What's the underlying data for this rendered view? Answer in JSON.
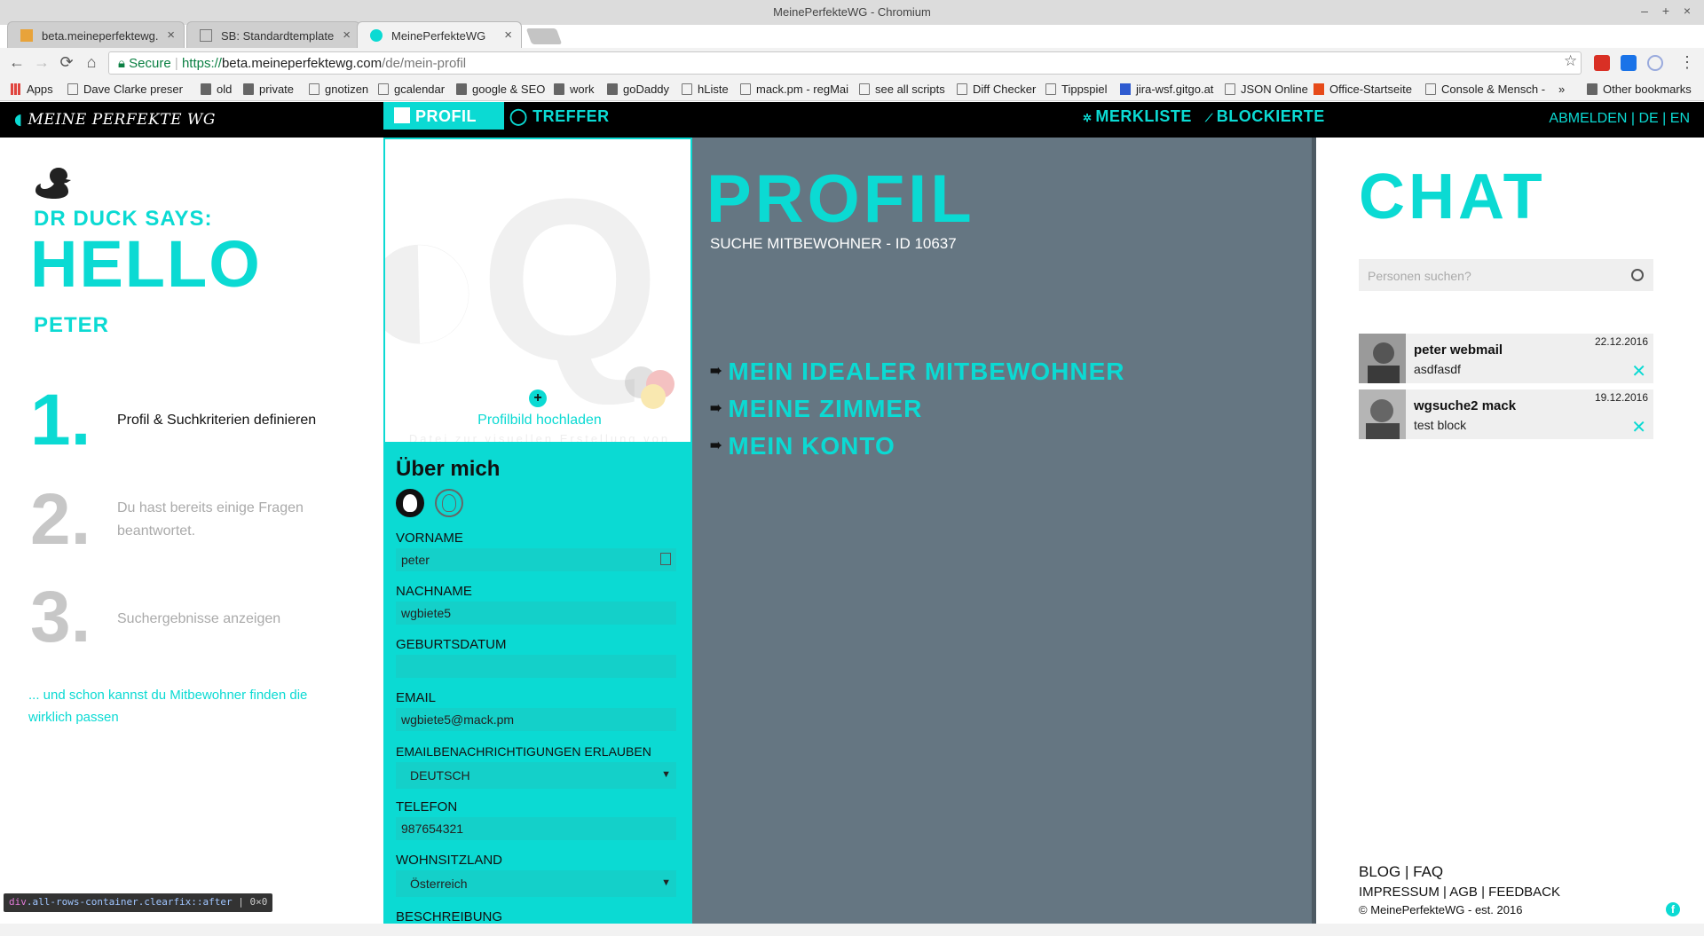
{
  "window": {
    "title": "MeinePerfekteWG - Chromium",
    "controls": [
      "–",
      "+",
      "×"
    ]
  },
  "tabs": [
    {
      "label": "beta.meineperfektewg.",
      "active": false,
      "close": "×"
    },
    {
      "label": "SB: Standardtemplate",
      "active": false,
      "close": "×"
    },
    {
      "label": "MeinePerfekteWG",
      "active": true,
      "close": "×"
    }
  ],
  "toolbar": {
    "back": "←",
    "forward": "→",
    "reload": "⟳",
    "home": "⌂",
    "secure_label": "Secure",
    "url_scheme": "https://",
    "url_host": "beta.meineperfektewg.com",
    "url_path": "/de/mein-profil",
    "star": "☆",
    "menu": "⋮"
  },
  "bookmarks": [
    {
      "label": "Apps",
      "icon": "apps-icon"
    },
    {
      "label": "Dave Clarke present",
      "icon": "page-icon"
    },
    {
      "label": "old",
      "icon": "folder-icon"
    },
    {
      "label": "private",
      "icon": "folder-icon"
    },
    {
      "label": "gnotizen",
      "icon": "page-icon"
    },
    {
      "label": "gcalendar",
      "icon": "page-icon"
    },
    {
      "label": "google & SEO",
      "icon": "folder-icon"
    },
    {
      "label": "work",
      "icon": "folder-icon"
    },
    {
      "label": "goDaddy",
      "icon": "folder-icon"
    },
    {
      "label": "hListe",
      "icon": "page-icon"
    },
    {
      "label": "mack.pm - regMai",
      "icon": "page-icon"
    },
    {
      "label": "see all scripts",
      "icon": "page-icon"
    },
    {
      "label": "Diff Checker",
      "icon": "page-icon"
    },
    {
      "label": "Tippspiel",
      "icon": "page-icon"
    },
    {
      "label": "jira-wsf.gitgo.at",
      "icon": "jira-icon"
    },
    {
      "label": "JSON Online",
      "icon": "page-icon"
    },
    {
      "label": "Office-Startseite",
      "icon": "office-icon"
    },
    {
      "label": "Console & Mensch -",
      "icon": "page-icon"
    }
  ],
  "bookmarks_more": "»",
  "bookmarks_other": "Other bookmarks",
  "app": {
    "logo": "MEINE PERFEKTE WG",
    "nav": {
      "profil": "PROFIL",
      "treffer": "TREFFER",
      "merkliste": "MERKLISTE",
      "blockierte": "BLOCKIERTE"
    },
    "right_nav": {
      "logout": "ABMELDEN",
      "de": "DE",
      "en": "EN"
    },
    "accent": "#0bdad3",
    "panel_bg": "#657682"
  },
  "left": {
    "duck_says": "DR DUCK SAYS:",
    "hello": "HELLO",
    "user": "PETER",
    "steps": [
      {
        "num": "1.",
        "text": "Profil & Suchkriterien definieren"
      },
      {
        "num": "2.",
        "text": "Du hast bereits einige Fragen beantwortet."
      },
      {
        "num": "3.",
        "text": "Suchergebnisse anzeigen"
      }
    ],
    "finder": "... und schon kannst du Mitbewohner finden die wirklich passen"
  },
  "form": {
    "upload_label": "Profilbild hochladen",
    "upload_sub": "Datei zur visuellen Erstellung von",
    "about": "Über mich",
    "fields": {
      "vorname": {
        "label": "VORNAME",
        "value": "peter"
      },
      "nachname": {
        "label": "NACHNAME",
        "value": "wgbiete5"
      },
      "geburtsdatum": {
        "label": "GEBURTSDATUM",
        "value": ""
      },
      "email": {
        "label": "EMAIL",
        "value": "wgbiete5@mack.pm"
      },
      "notifications": {
        "label": "EMAILBENACHRICHTIGUNGEN ERLAUBEN",
        "value": "DEUTSCH"
      },
      "telefon": {
        "label": "TELEFON",
        "value": "987654321"
      },
      "wohnsitzland": {
        "label": "WOHNSITZLAND",
        "value": "Österreich"
      },
      "beschreibung": {
        "label": "BESCHREIBUNG"
      }
    }
  },
  "panel": {
    "title": "PROFIL",
    "subtitle": "SUCHE MITBEWOHNER - ID 10637",
    "links": [
      "MEIN IDEALER MITBEWOHNER",
      "MEINE ZIMMER",
      "MEIN KONTO"
    ]
  },
  "chat": {
    "title": "CHAT",
    "search_placeholder": "Personen suchen?",
    "conversations": [
      {
        "name": "peter webmail",
        "message": "asdfasdf",
        "date": "22.12.2016"
      },
      {
        "name": "wgsuche2 mack",
        "message": "test block",
        "date": "19.12.2016"
      }
    ],
    "footer": {
      "blog": "BLOG",
      "faq": "FAQ",
      "impressum": "IMPRESSUM",
      "agb": "AGB",
      "feedback": "FEEDBACK",
      "copyright": "© MeinePerfekteWG - est. 2016"
    }
  },
  "devtools_tip": {
    "tag": "div",
    "classes": ".all-rows-container.clearfix::after",
    "size": "0×0"
  }
}
